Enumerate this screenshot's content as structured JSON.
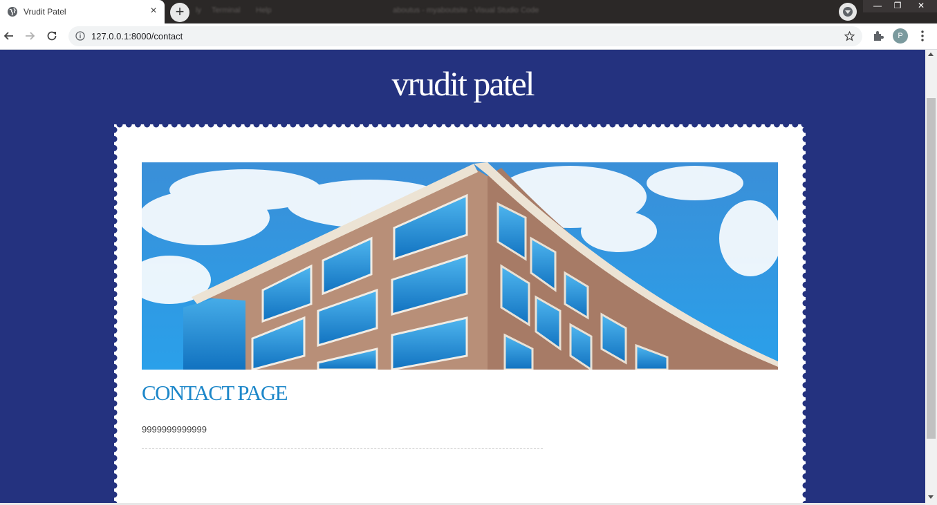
{
  "browser": {
    "tab_title": "Vrudit Patel",
    "tab_close": "×",
    "new_tab": "+",
    "background_menu": [
      "ly",
      "Terminal",
      "Help"
    ],
    "background_window_title": "aboutus - myaboutsite - Visual Studio Code",
    "url": "127.0.0.1:8000/contact",
    "profile_initial": "P",
    "window_controls": {
      "minimize": "—",
      "restore": "❐",
      "close": "✕"
    }
  },
  "page": {
    "site_title": "vrudit patel",
    "heading": "CONTACT PAGE",
    "phone": "9999999999999"
  },
  "colors": {
    "page_background": "#24327f",
    "heading": "#1d87c9",
    "card": "#ffffff"
  },
  "icons": [
    "globe-icon",
    "close-icon",
    "plus-icon",
    "back-arrow-icon",
    "forward-arrow-icon",
    "reload-icon",
    "info-icon",
    "star-icon",
    "puzzle-icon",
    "kebab-menu-icon"
  ]
}
